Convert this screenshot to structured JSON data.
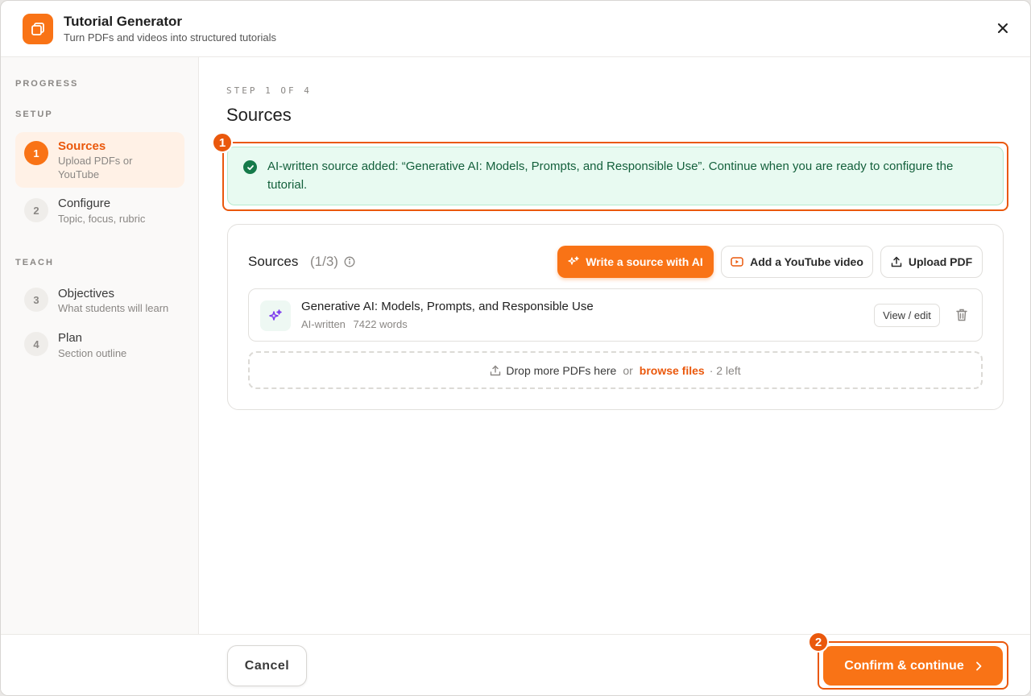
{
  "header": {
    "title": "Tutorial Generator",
    "subtitle": "Turn PDFs and videos into structured tutorials"
  },
  "sidebar": {
    "progress_label": "PROGRESS",
    "setup_label": "SETUP",
    "teach_label": "TEACH",
    "items": [
      {
        "num": "1",
        "title": "Sources",
        "desc": "Upload PDFs or YouTube"
      },
      {
        "num": "2",
        "title": "Configure",
        "desc": "Topic, focus, rubric"
      },
      {
        "num": "3",
        "title": "Objectives",
        "desc": "What students will learn"
      },
      {
        "num": "4",
        "title": "Plan",
        "desc": "Section outline"
      }
    ]
  },
  "main": {
    "step_label": "STEP 1 OF 4",
    "title": "Sources",
    "alert": "AI-written source added: “Generative AI: Models, Prompts, and Responsible Use”. Continue when you are ready to configure the tutorial.",
    "card": {
      "title": "Sources",
      "count": "(1/3)",
      "write_ai_label": "Write a source with AI",
      "youtube_label": "Add a YouTube video",
      "upload_label": "Upload PDF",
      "source": {
        "title": "Generative AI: Models, Prompts, and Responsible Use",
        "type": "AI-written",
        "words": "7422 words",
        "view_label": "View / edit"
      },
      "dropzone": {
        "text": "Drop more PDFs here",
        "or": "or",
        "link": "browse files",
        "remaining": "· 2 left"
      }
    }
  },
  "highlights": [
    "1",
    "2"
  ],
  "footer": {
    "cancel_label": "Cancel",
    "confirm_label": "Confirm & continue"
  },
  "colors": {
    "accent": "#f97316",
    "highlight": "#ea580c",
    "success": "#157a4a"
  }
}
